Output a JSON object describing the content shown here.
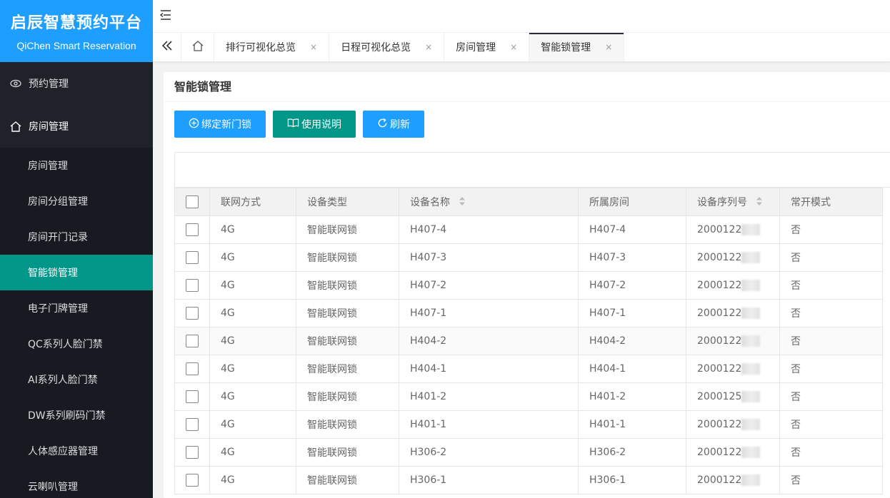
{
  "brand": {
    "title": "启辰智慧预约平台",
    "subtitle": "QiChen Smart Reservation"
  },
  "sidebar": {
    "top_items": [
      {
        "label": "预约管理",
        "icon": "eye-icon"
      },
      {
        "label": "房间管理",
        "icon": "home-icon"
      }
    ],
    "sub_items": [
      {
        "label": "房间管理"
      },
      {
        "label": "房间分组管理"
      },
      {
        "label": "房间开门记录"
      },
      {
        "label": "智能锁管理",
        "active": true
      },
      {
        "label": "电子门牌管理"
      },
      {
        "label": "QC系列人脸门禁"
      },
      {
        "label": "AI系列人脸门禁"
      },
      {
        "label": "DW系列刷码门禁"
      },
      {
        "label": "人体感应器管理"
      },
      {
        "label": "云喇叭管理"
      }
    ]
  },
  "tabs": [
    {
      "label": "排行可视化总览"
    },
    {
      "label": "日程可视化总览"
    },
    {
      "label": "房间管理"
    },
    {
      "label": "智能锁管理",
      "active": true
    }
  ],
  "tab_close_glyph": "×",
  "main": {
    "title": "智能锁管理",
    "buttons": {
      "bind": "绑定新门锁",
      "manual": "使用说明",
      "refresh": "刷新"
    }
  },
  "table": {
    "headers": [
      "联网方式",
      "设备类型",
      "设备名称",
      "所属房间",
      "设备序列号",
      "常开模式"
    ],
    "rows": [
      {
        "net": "4G",
        "type": "智能联网锁",
        "name": "H407-4",
        "room": "H407-4",
        "serial": "2000122",
        "mode": "否"
      },
      {
        "net": "4G",
        "type": "智能联网锁",
        "name": "H407-3",
        "room": "H407-3",
        "serial": "2000122",
        "mode": "否"
      },
      {
        "net": "4G",
        "type": "智能联网锁",
        "name": "H407-2",
        "room": "H407-2",
        "serial": "2000122",
        "mode": "否"
      },
      {
        "net": "4G",
        "type": "智能联网锁",
        "name": "H407-1",
        "room": "H407-1",
        "serial": "2000122",
        "mode": "否"
      },
      {
        "net": "4G",
        "type": "智能联网锁",
        "name": "H404-2",
        "room": "H404-2",
        "serial": "2000122",
        "mode": "否"
      },
      {
        "net": "4G",
        "type": "智能联网锁",
        "name": "H404-1",
        "room": "H404-1",
        "serial": "2000122",
        "mode": "否"
      },
      {
        "net": "4G",
        "type": "智能联网锁",
        "name": "H401-2",
        "room": "H401-2",
        "serial": "2000125",
        "mode": "否"
      },
      {
        "net": "4G",
        "type": "智能联网锁",
        "name": "H401-1",
        "room": "H401-1",
        "serial": "2000122",
        "mode": "否"
      },
      {
        "net": "4G",
        "type": "智能联网锁",
        "name": "H306-2",
        "room": "H306-2",
        "serial": "2000122",
        "mode": "否"
      },
      {
        "net": "4G",
        "type": "智能联网锁",
        "name": "H306-1",
        "room": "H306-1",
        "serial": "2000122",
        "mode": "否"
      }
    ]
  }
}
